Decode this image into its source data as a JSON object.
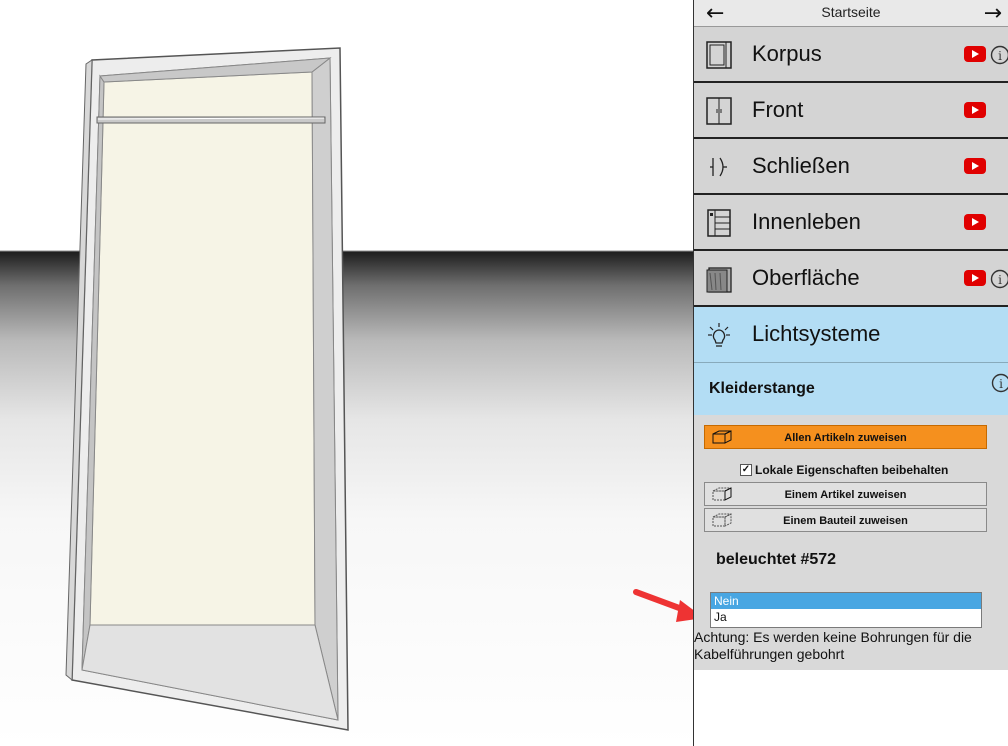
{
  "nav": {
    "title": "Startseite",
    "back_icon": "arrow-left-icon",
    "forward_icon": "arrow-right-icon"
  },
  "menu": [
    {
      "label": "Korpus",
      "icon": "cabinet-body-icon",
      "video": true,
      "info": true
    },
    {
      "label": "Front",
      "icon": "door-front-icon",
      "video": true,
      "info": false
    },
    {
      "label": "Schließen",
      "icon": "closing-icon",
      "video": true,
      "info": false
    },
    {
      "label": "Innenleben",
      "icon": "interior-icon",
      "video": true,
      "info": false
    },
    {
      "label": "Oberfläche",
      "icon": "surface-icon",
      "video": true,
      "info": true
    },
    {
      "label": "Lichtsysteme",
      "icon": "lightbulb-icon",
      "video": false,
      "info": false,
      "active": true
    }
  ],
  "section": {
    "title": "Kleiderstange",
    "assign_all": "Allen Artikeln zuweisen",
    "keep_local": "Lokale Eigenschaften beibehalten",
    "keep_local_checked": true,
    "assign_article": "Einem Artikel zuweisen",
    "assign_part": "Einem Bauteil zuweisen",
    "property_label": "beleuchtet #572",
    "options": [
      "Nein",
      "Ja"
    ],
    "selected_option": "Nein",
    "note": "Achtung: Es werden keine Bohrungen für die Kabelführungen gebohrt"
  },
  "colors": {
    "accent_blue": "#b3ddf4",
    "orange": "#f5901e",
    "youtube_red": "#e00000",
    "selection_blue": "#48a6e2"
  }
}
